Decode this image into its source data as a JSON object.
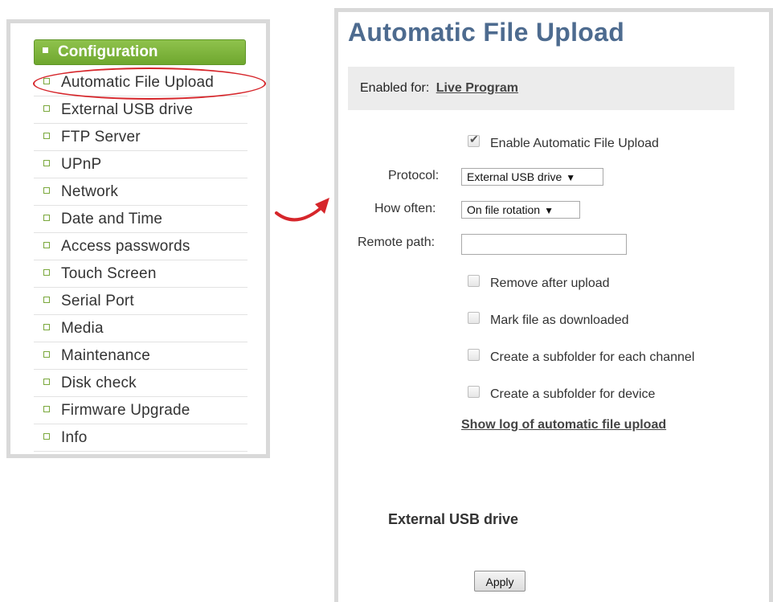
{
  "nav": {
    "header": "Configuration",
    "items": [
      "Automatic File Upload",
      "External USB drive",
      "FTP Server",
      "UPnP",
      "Network",
      "Date and Time",
      "Access passwords",
      "Touch Screen",
      "Serial Port",
      "Media",
      "Maintenance",
      "Disk check",
      "Firmware Upgrade",
      "Info"
    ],
    "highlighted_item": "Automatic File Upload"
  },
  "page": {
    "title": "Automatic File Upload",
    "enabled_for_label": "Enabled for:",
    "enabled_for_link": "Live Program"
  },
  "form": {
    "enable_label": "Enable Automatic File Upload",
    "enable_checked": true,
    "protocol_label": "Protocol:",
    "protocol_value": "External USB drive",
    "how_often_label": "How often:",
    "how_often_value": "On file rotation",
    "remote_path_label": "Remote path:",
    "remote_path_value": "",
    "options": [
      {
        "label": "Remove after upload",
        "checked": false
      },
      {
        "label": "Mark file as downloaded",
        "checked": false
      },
      {
        "label": "Create a subfolder for each channel",
        "checked": false
      },
      {
        "label": "Create a subfolder for device",
        "checked": false
      }
    ],
    "log_link": "Show log of automatic file upload"
  },
  "section": {
    "title": "External USB drive",
    "apply_label": "Apply"
  },
  "colors": {
    "accent_green": "#7ab13a",
    "title_blue": "#4d6b8f",
    "annotation_red": "#d6262b"
  }
}
